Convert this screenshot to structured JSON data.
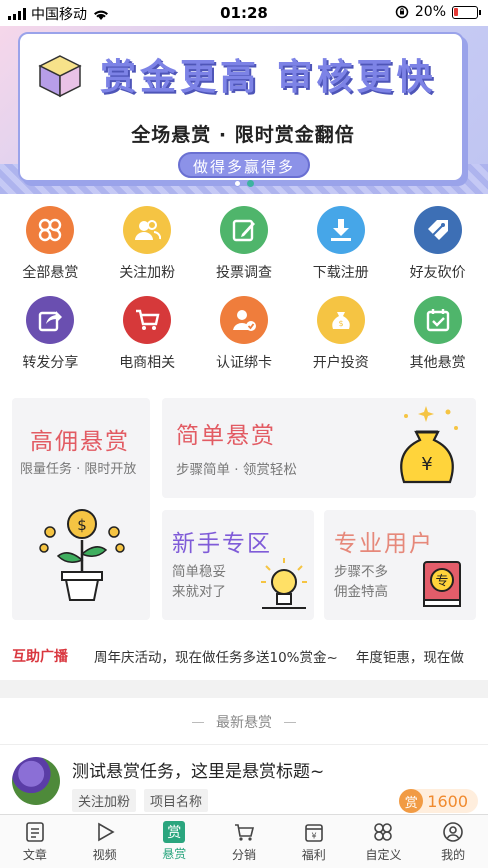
{
  "status_bar": {
    "carrier": "中国移动",
    "time": "01:28",
    "battery": "20%",
    "battery_level": 0.2
  },
  "banner": {
    "headline": "赏金更高 审核更快",
    "subtitle": "全场悬赏 · 限时赏金翻倍",
    "pill": "做得多赢得多",
    "page_count": 2,
    "active_page": 1
  },
  "categories": [
    {
      "label": "全部悬赏",
      "icon": "clover-icon",
      "color": "#ef7d3c"
    },
    {
      "label": "关注加粉",
      "icon": "users-icon",
      "color": "#f5c443"
    },
    {
      "label": "投票调查",
      "icon": "edit-icon",
      "color": "#4fb56b"
    },
    {
      "label": "下载注册",
      "icon": "download-icon",
      "color": "#46a6e8"
    },
    {
      "label": "好友砍价",
      "icon": "tag-icon",
      "color": "#3d6fb5"
    },
    {
      "label": "转发分享",
      "icon": "share-icon",
      "color": "#6a4fb0"
    },
    {
      "label": "电商相关",
      "icon": "cart-icon",
      "color": "#d6393a"
    },
    {
      "label": "认证绑卡",
      "icon": "verify-user-icon",
      "color": "#ef7d3c"
    },
    {
      "label": "开户投资",
      "icon": "money-bag-icon",
      "color": "#f5c443"
    },
    {
      "label": "其他悬赏",
      "icon": "calendar-check-icon",
      "color": "#4fb56b"
    }
  ],
  "tiles": {
    "high": {
      "title": "高佣悬赏",
      "desc": "限量任务 · 限时开放"
    },
    "simple": {
      "title": "简单悬赏",
      "desc": "步骤简单 · 领赏轻松"
    },
    "newbie": {
      "title": "新手专区",
      "desc_line1": "简单稳妥",
      "desc_line2": "来就对了"
    },
    "pro": {
      "title": "专业用户",
      "desc_line1": "步骤不多",
      "desc_line2": "佣金特高"
    }
  },
  "ticker": {
    "tag": "互助广播",
    "messages": [
      "周年庆活动，现在做任务多送10%赏金~",
      "年度钜惠，现在做"
    ]
  },
  "latest": {
    "title": "最新悬赏"
  },
  "task": {
    "title": "测试悬赏任务，这里是悬赏标题~",
    "chips": [
      "关注加粉",
      "项目名称"
    ],
    "reward_badge": "赏",
    "reward_amount": "1600"
  },
  "tabbar": [
    {
      "label": "文章",
      "icon": "article-icon",
      "active": false
    },
    {
      "label": "视频",
      "icon": "play-icon",
      "active": false
    },
    {
      "label": "悬赏",
      "icon": "reward-icon",
      "active": true
    },
    {
      "label": "分销",
      "icon": "cart-icon",
      "active": false
    },
    {
      "label": "福利",
      "icon": "welfare-icon",
      "active": false
    },
    {
      "label": "自定义",
      "icon": "grid-icon",
      "active": false
    },
    {
      "label": "我的",
      "icon": "user-icon",
      "active": false
    }
  ],
  "colors": {
    "accent": "#2aa57e",
    "red": "#e25b63",
    "orange": "#f08a2e"
  }
}
